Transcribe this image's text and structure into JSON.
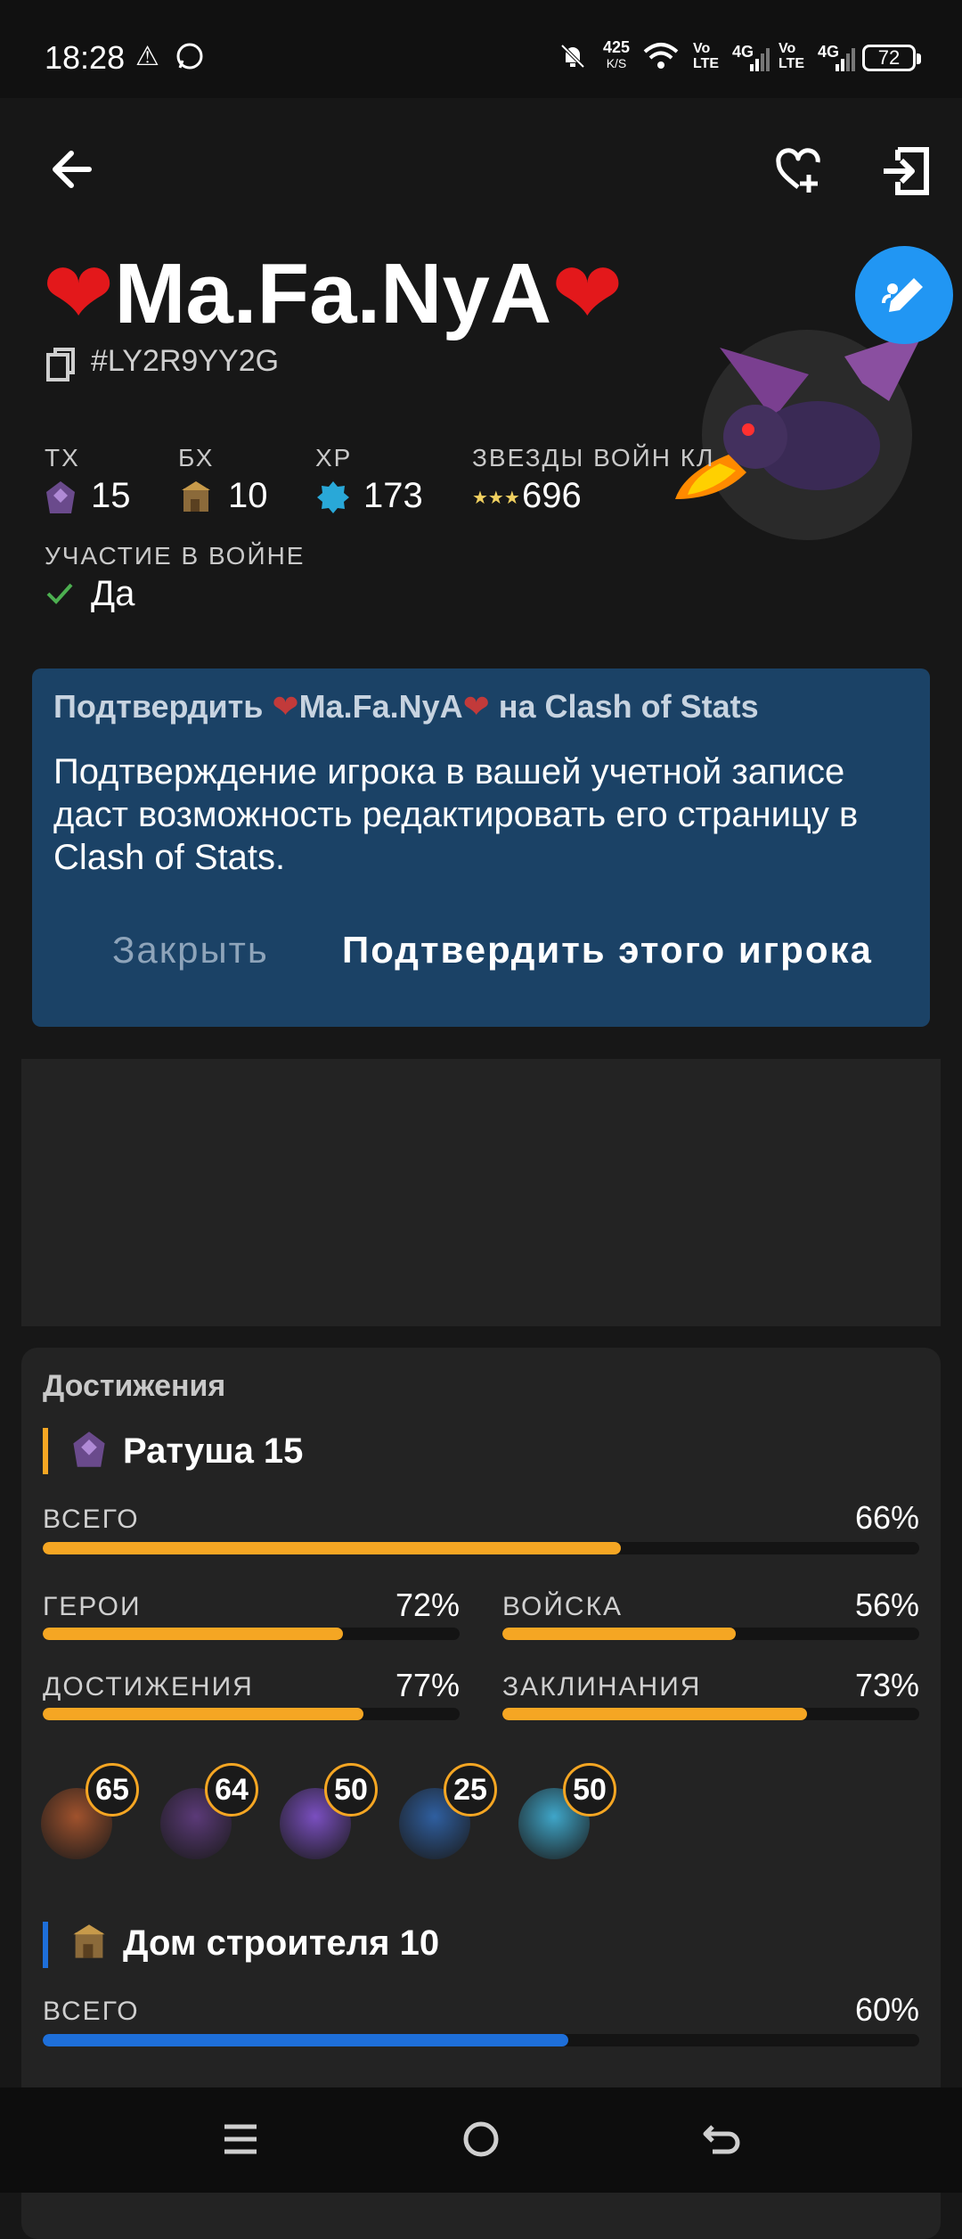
{
  "status_bar": {
    "time": "18:28",
    "speed_value": "425",
    "speed_unit": "K/S",
    "net1": "Vo\nLTE",
    "net2": "4G",
    "battery": "72"
  },
  "header": {
    "back_icon": "arrow-left-icon",
    "favorite_icon": "heart-plus-icon",
    "logout_icon": "exit-icon",
    "player_name": "Ma.Fa.NyA",
    "player_tag": "#LY2R9YY2G",
    "edit_icon": "pencil-icon"
  },
  "stats": {
    "th_label": "ТХ",
    "th_value": "15",
    "bh_label": "БХ",
    "bh_value": "10",
    "xp_label": "XP",
    "xp_value": "173",
    "war_stars_label": "ЗВЕЗДЫ ВОЙН КЛ",
    "war_stars_value": "696",
    "war_pref_label": "УЧАСТИЕ В ВОЙНЕ",
    "war_pref_value": "Да"
  },
  "verify_card": {
    "title_prefix": "Подтвердить ",
    "title_name": "Ma.Fa.NyA",
    "title_suffix": " на Clash of Stats",
    "text": "Подтверждение игрока в вашей учетной записе даст возможность редактировать его страницу в Clash of Stats.",
    "close_label": "Закрыть",
    "confirm_label": "Подтвердить этого игрока"
  },
  "achievements": {
    "title": "Достижения",
    "home": {
      "title": "Ратуша 15",
      "total_label": "ВСЕГО",
      "total_value": "66%",
      "total_frac": 0.66,
      "heroes_label": "ГЕРОИ",
      "heroes_value": "72%",
      "heroes_frac": 0.72,
      "troops_label": "ВОЙСКА",
      "troops_value": "56%",
      "troops_frac": 0.56,
      "ach_label": "ДОСТИЖЕНИЯ",
      "ach_value": "77%",
      "ach_frac": 0.77,
      "spells_label": "ЗАКЛИНАНИЯ",
      "spells_value": "73%",
      "spells_frac": 0.73,
      "heroes": [
        {
          "level": "65",
          "color": "#a0522d"
        },
        {
          "level": "64",
          "color": "#5b3a78"
        },
        {
          "level": "50",
          "color": "#7a4fc0"
        },
        {
          "level": "25",
          "color": "#2f5fa0"
        },
        {
          "level": "50",
          "color": "#3fa6c9"
        }
      ]
    },
    "builder": {
      "title": "Дом строителя 10",
      "total_label": "ВСЕГО",
      "total_value": "60%",
      "total_frac": 0.6
    }
  },
  "colors": {
    "accent_orange": "#f5a623",
    "accent_blue": "#1e6fd9",
    "card_bg": "#1b4266",
    "fab": "#2196f3"
  },
  "nav": {
    "menu_icon": "menu-icon",
    "home_icon": "circle-home-icon",
    "back_icon": "back-gesture-icon"
  }
}
